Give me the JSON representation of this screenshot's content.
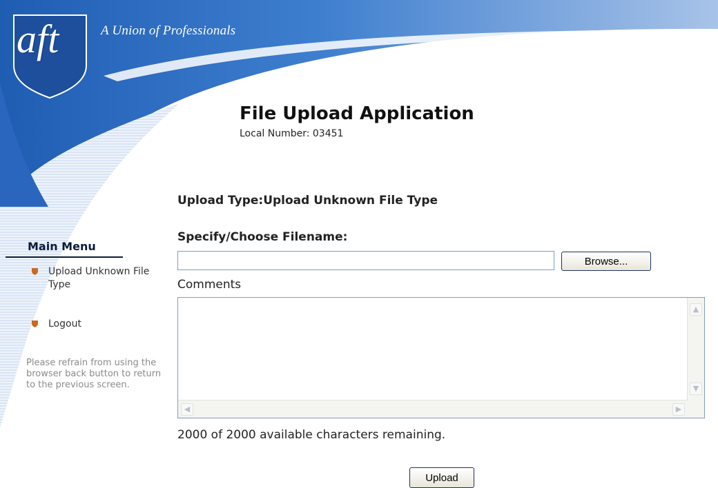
{
  "header": {
    "logo_text": "aft",
    "tagline": "A Union of Professionals",
    "title": "File Upload Application",
    "local_number": "Local Number: 03451"
  },
  "sidebar": {
    "title": "Main Menu",
    "items": [
      {
        "label": "Upload Unknown File Type",
        "icon": "shield-bullet-icon"
      },
      {
        "label": "Logout",
        "icon": "shield-bullet-icon"
      }
    ],
    "note": "Please refrain from using the browser back button to return to the previous screen."
  },
  "form": {
    "upload_type": "Upload Type:Upload Unknown File Type",
    "filename_label": "Specify/Choose Filename:",
    "filename_value": "",
    "browse_label": "Browse...",
    "comments_label": "Comments",
    "comments_value": "",
    "chars_remaining": "2000 of 2000 available characters remaining.",
    "upload_label": "Upload"
  },
  "colors": {
    "banner_blue": "#2f6fc1",
    "banner_light": "#8fb2e0",
    "shield_blue": "#1d4f9c",
    "bullet_orange": "#c96a1e",
    "menu_title": "#0b1b3a"
  }
}
